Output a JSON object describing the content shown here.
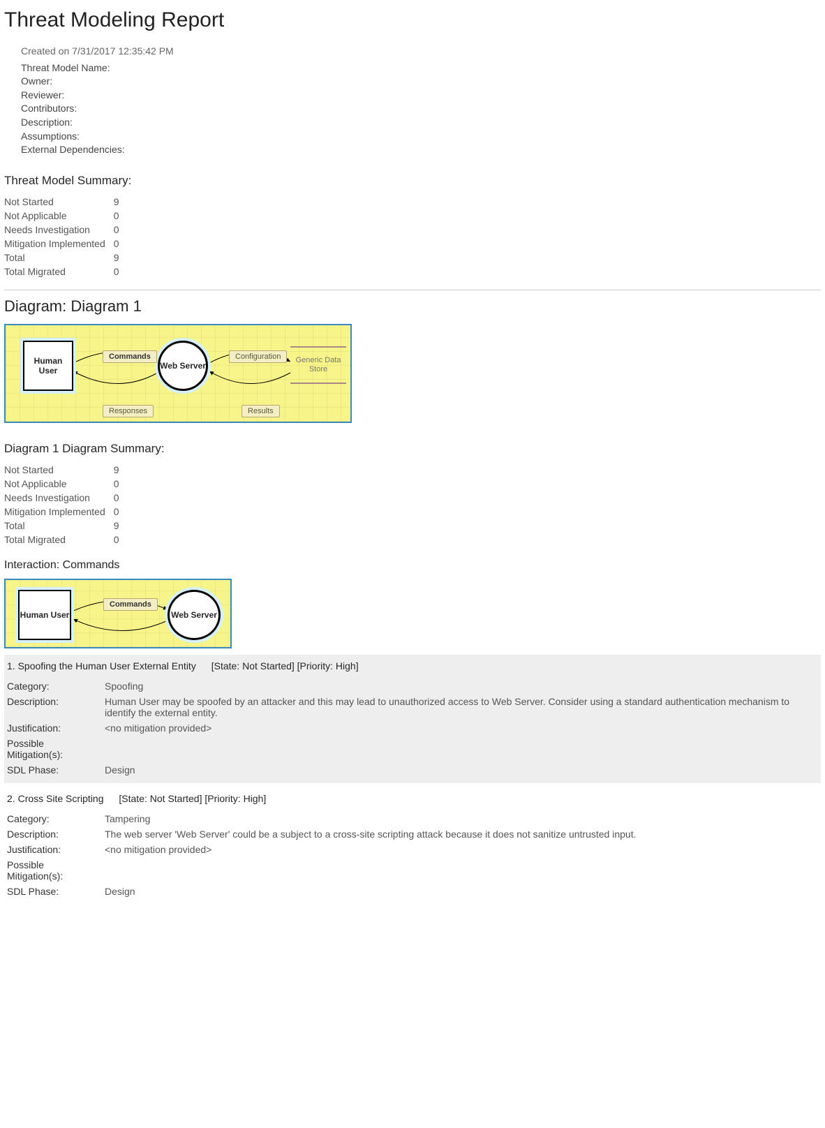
{
  "title": "Threat Modeling Report",
  "created": "Created on 7/31/2017 12:35:42 PM",
  "meta": {
    "model_name_label": "Threat Model Name:",
    "owner_label": "Owner:",
    "reviewer_label": "Reviewer:",
    "contributors_label": "Contributors:",
    "description_label": "Description:",
    "assumptions_label": "Assumptions:",
    "ext_dep_label": "External Dependencies:"
  },
  "summary_heading": "Threat Model Summary:",
  "summary": [
    {
      "label": "Not Started",
      "value": "9"
    },
    {
      "label": "Not Applicable",
      "value": "0"
    },
    {
      "label": "Needs Investigation",
      "value": "0"
    },
    {
      "label": "Mitigation Implemented",
      "value": "0"
    },
    {
      "label": "Total",
      "value": "9"
    },
    {
      "label": "Total Migrated",
      "value": "0"
    }
  ],
  "diagram_heading": "Diagram: Diagram 1",
  "diagram1": {
    "nodes": {
      "human_user": "Human User",
      "web_server": "Web Server",
      "data_store": "Generic Data Store"
    },
    "flows": {
      "commands": "Commands",
      "responses": "Responses",
      "configuration": "Configuration",
      "results": "Results"
    }
  },
  "diagram_summary_heading": "Diagram 1 Diagram Summary:",
  "diagram_summary": [
    {
      "label": "Not Started",
      "value": "9"
    },
    {
      "label": "Not Applicable",
      "value": "0"
    },
    {
      "label": "Needs Investigation",
      "value": "0"
    },
    {
      "label": "Mitigation Implemented",
      "value": "0"
    },
    {
      "label": "Total",
      "value": "9"
    },
    {
      "label": "Total Migrated",
      "value": "0"
    }
  ],
  "interaction_heading": "Interaction: Commands",
  "threats": [
    {
      "num": "1.",
      "title": "Spoofing the Human User External Entity",
      "state": "[State: Not Started]",
      "priority": "[Priority: High]",
      "category_label": "Category:",
      "category": "Spoofing",
      "description_label": "Description:",
      "description": "Human User may be spoofed by an attacker and this may lead to unauthorized access to Web Server. Consider using a standard authentication mechanism to identify the external entity.",
      "justification_label": "Justification:",
      "justification": "<no mitigation provided>",
      "mitigations_label": "Possible Mitigation(s):",
      "mitigations": "",
      "sdl_label": "SDL Phase:",
      "sdl": "Design",
      "shaded": true
    },
    {
      "num": "2.",
      "title": "Cross Site Scripting",
      "state": "[State: Not Started]",
      "priority": "[Priority: High]",
      "category_label": "Category:",
      "category": "Tampering",
      "description_label": "Description:",
      "description": "The web server 'Web Server' could be a subject to a cross-site scripting attack because it does not sanitize untrusted input.",
      "justification_label": "Justification:",
      "justification": "<no mitigation provided>",
      "mitigations_label": "Possible Mitigation(s):",
      "mitigations": "",
      "sdl_label": "SDL Phase:",
      "sdl": "Design",
      "shaded": false
    }
  ]
}
